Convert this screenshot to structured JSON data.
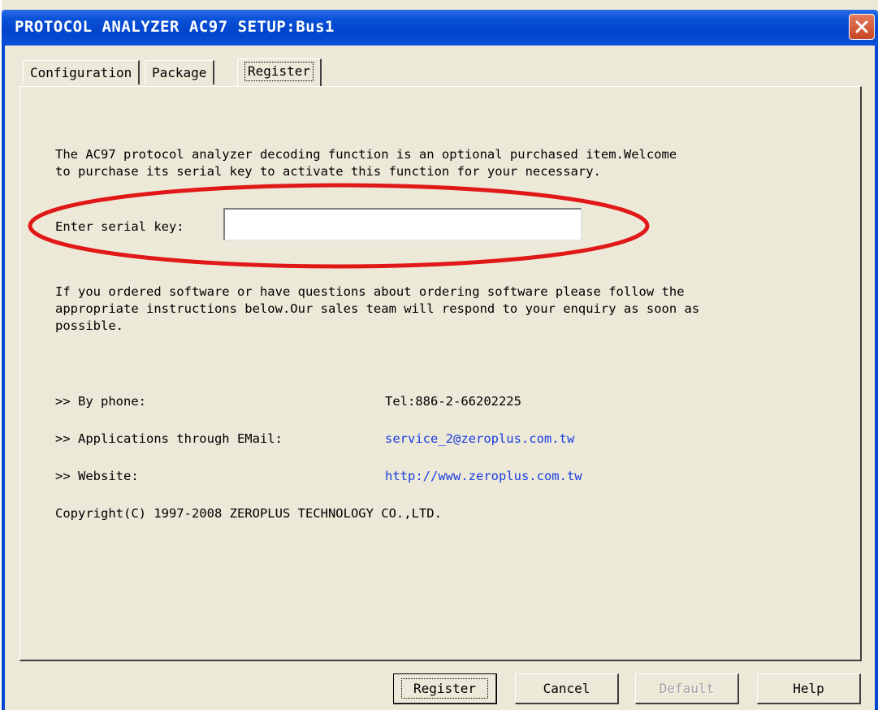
{
  "window": {
    "title": "PROTOCOL ANALYZER AC97 SETUP:Bus1"
  },
  "tabs": [
    {
      "label": "Configuration"
    },
    {
      "label": "Package"
    },
    {
      "label": "Register"
    }
  ],
  "register": {
    "intro_line1": "The AC97 protocol analyzer decoding function is an optional purchased item.Welcome",
    "intro_line2": "to purchase its serial key to activate this function for your necessary.",
    "serial_label": "Enter serial key:",
    "serial_value": "",
    "ordering_line1": "If you ordered software or have questions about ordering software please follow the",
    "ordering_line2": "appropriate instructions below.Our sales team will respond to your enquiry as soon as",
    "ordering_line3": "possible.",
    "contacts": [
      {
        "label": ">> By phone:",
        "value": "Tel:886-2-66202225"
      },
      {
        "label": ">> Applications through EMail:",
        "value": "service_2@zeroplus.com.tw"
      },
      {
        "label": ">> Website:",
        "value": "http://www.zeroplus.com.tw"
      }
    ],
    "copyright": "Copyright(C) 1997-2008 ZEROPLUS TECHNOLOGY CO.,LTD."
  },
  "buttons": {
    "register": "Register",
    "cancel": "Cancel",
    "default": "Default",
    "help": "Help"
  },
  "colors": {
    "titlebar": "#0144cc",
    "dialog_bg": "#ece9d8",
    "link": "#1a3ce0",
    "highlight_ellipse": "#e01818"
  },
  "icons": {
    "close": "close-icon"
  }
}
